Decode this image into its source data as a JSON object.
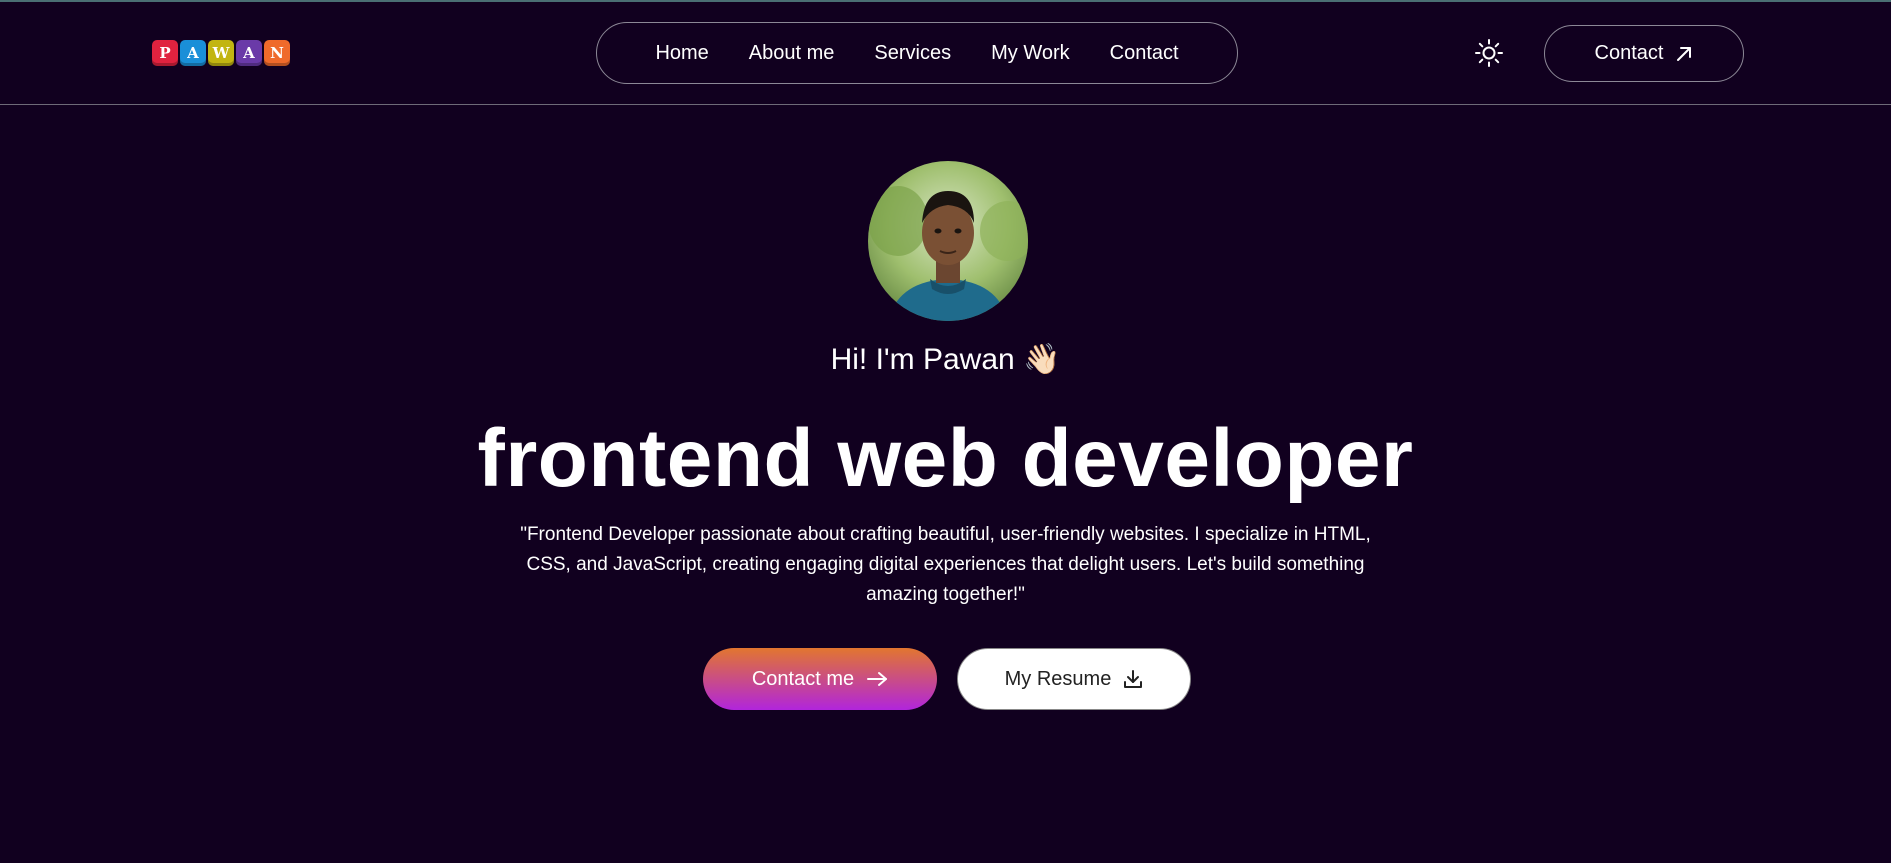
{
  "logo": {
    "letters": [
      {
        "char": "P",
        "color": "#e0223f"
      },
      {
        "char": "A",
        "color": "#1a8fd8"
      },
      {
        "char": "W",
        "color": "#c2b512"
      },
      {
        "char": "A",
        "color": "#6a3aa8"
      },
      {
        "char": "N",
        "color": "#ef6a2b"
      }
    ]
  },
  "nav": {
    "items": [
      "Home",
      "About me",
      "Services",
      "My Work",
      "Contact"
    ]
  },
  "header": {
    "theme_icon": "sun-icon",
    "contact_label": "Contact",
    "contact_icon": "arrow-up-right-icon"
  },
  "hero": {
    "greeting": "Hi! I'm Pawan",
    "greeting_emoji": "👋🏻",
    "title": "frontend web developer",
    "bio": "\"Frontend Developer passionate about crafting beautiful, user-friendly websites. I specialize in HTML, CSS, and JavaScript, creating engaging digital experiences that delight users. Let's build something amazing together!\"",
    "primary_button": "Contact me",
    "primary_icon": "arrow-right-icon",
    "secondary_button": "My Resume",
    "secondary_icon": "download-icon"
  },
  "colors": {
    "background": "#11001f",
    "gradient_start": "#e2762f",
    "gradient_end": "#b125dc"
  }
}
